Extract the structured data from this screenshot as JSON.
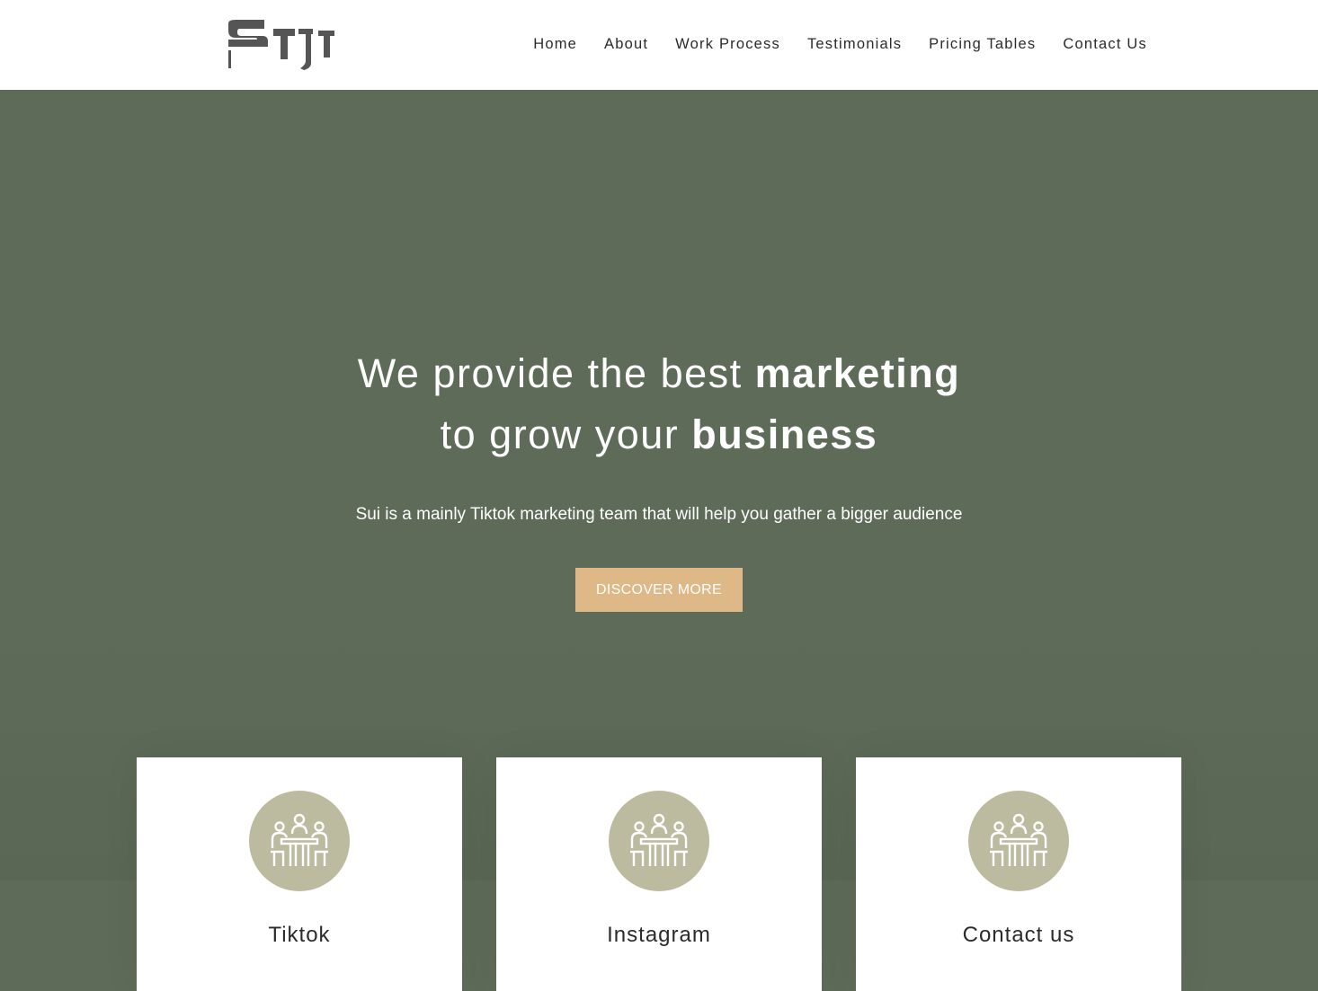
{
  "brand": {
    "logo_text": "SUI",
    "logo_color": "#555555"
  },
  "nav": {
    "items": [
      {
        "label": "Home"
      },
      {
        "label": "About"
      },
      {
        "label": "Work Process"
      },
      {
        "label": "Testimonials"
      },
      {
        "label": "Pricing Tables"
      },
      {
        "label": "Contact Us"
      }
    ]
  },
  "hero": {
    "title_line1_normal": "We provide the best ",
    "title_line1_bold": "marketing",
    "title_line2_normal": "to grow your ",
    "title_line2_bold": "business",
    "subtitle": "Sui is a mainly Tiktok marketing team that will help you gather a bigger audience",
    "cta_label": "DISCOVER MORE",
    "background_color": "#5f6b59",
    "cta_color": "#deb887"
  },
  "cards": [
    {
      "title": "Tiktok",
      "icon": "meeting-people-icon"
    },
    {
      "title": "Instagram",
      "icon": "meeting-people-icon"
    },
    {
      "title": "Contact us",
      "icon": "meeting-people-icon"
    }
  ],
  "colors": {
    "icon_circle": "#bcbb9f",
    "card_background": "#ffffff"
  }
}
